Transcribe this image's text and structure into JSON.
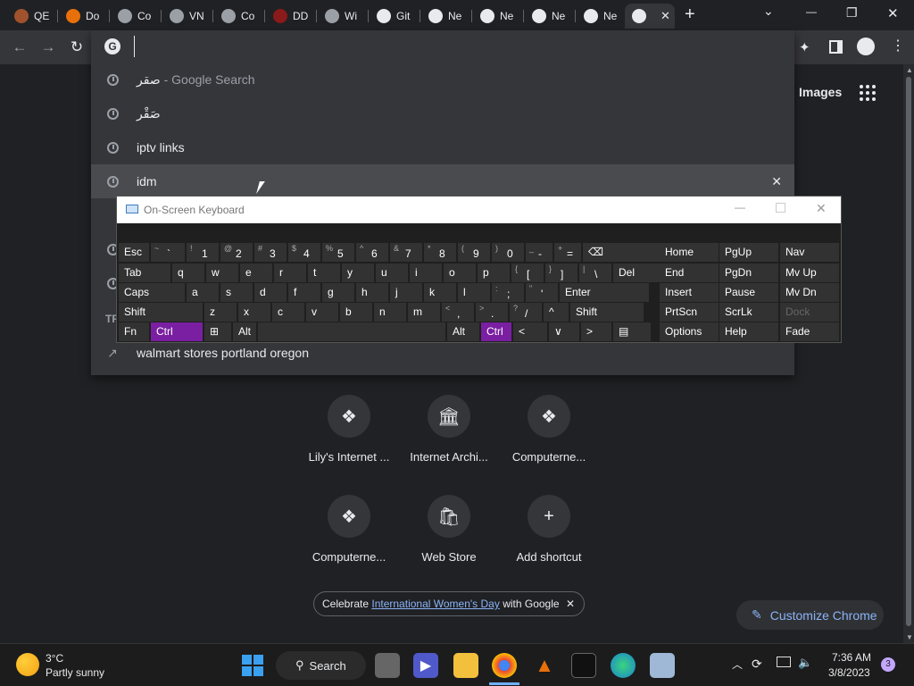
{
  "tabs": [
    {
      "label": "QE",
      "icon": "tab-favicon-qe",
      "color": "#a0522d"
    },
    {
      "label": "Do",
      "icon": "vlc-icon",
      "color": "#e8700a"
    },
    {
      "label": "Co",
      "icon": "computerese-icon",
      "color": "#9aa0a6"
    },
    {
      "label": "VN",
      "icon": "computerese-icon",
      "color": "#9aa0a6"
    },
    {
      "label": "Co",
      "icon": "computerese-icon",
      "color": "#9aa0a6"
    },
    {
      "label": "DD",
      "icon": "ddg-icon",
      "color": "#8b1a1a"
    },
    {
      "label": "Wi",
      "icon": "wiki-icon",
      "color": "#9aa0a6"
    },
    {
      "label": "Git",
      "icon": "github-icon",
      "color": "#e8eaed"
    },
    {
      "label": "Ne",
      "icon": "chrome-icon",
      "color": "#e8eaed"
    },
    {
      "label": "Ne",
      "icon": "chrome-icon",
      "color": "#e8eaed"
    },
    {
      "label": "Ne",
      "icon": "chrome-icon",
      "color": "#e8eaed"
    },
    {
      "label": "Ne",
      "icon": "chrome-icon",
      "color": "#e8eaed"
    }
  ],
  "active_tab": {
    "close": "✕"
  },
  "new_tab": "+",
  "window": {
    "minimize": "—",
    "restore": "❐",
    "close": "✕",
    "tabsearch": "⌄"
  },
  "nav": {
    "back": "←",
    "forward": "→",
    "reload": "↻"
  },
  "omnibox": {
    "value": "",
    "suggestions": [
      {
        "text": "صقر",
        "suffix": " - Google Search",
        "icon": "history"
      },
      {
        "text": "صَقْر",
        "suffix": "",
        "icon": "history"
      },
      {
        "text": "iptv links",
        "suffix": "",
        "icon": "history"
      },
      {
        "text": "idm",
        "suffix": "",
        "icon": "history",
        "remove": "✕"
      }
    ],
    "trending_header": "TR",
    "trending": [
      {
        "text": "walmart stores portland oregon",
        "icon": "trending"
      }
    ]
  },
  "header_right": {
    "images": "Images"
  },
  "osk": {
    "title": "On-Screen Keyboard",
    "rows": [
      [
        {
          "m": "Esc"
        },
        {
          "s": "~",
          "m": "`"
        },
        {
          "s": "!",
          "m": "1"
        },
        {
          "s": "@",
          "m": "2"
        },
        {
          "s": "#",
          "m": "3"
        },
        {
          "s": "$",
          "m": "4"
        },
        {
          "s": "%",
          "m": "5"
        },
        {
          "s": "^",
          "m": "6"
        },
        {
          "s": "&",
          "m": "7"
        },
        {
          "s": "*",
          "m": "8"
        },
        {
          "s": "(",
          "m": "9"
        },
        {
          "s": ")",
          "m": "0"
        },
        {
          "s": "_",
          "m": "-"
        },
        {
          "s": "+",
          "m": "="
        },
        {
          "m": "⌫"
        }
      ],
      [
        {
          "m": "Tab"
        },
        {
          "m": "q"
        },
        {
          "m": "w"
        },
        {
          "m": "e"
        },
        {
          "m": "r"
        },
        {
          "m": "t"
        },
        {
          "m": "y"
        },
        {
          "m": "u"
        },
        {
          "m": "i"
        },
        {
          "m": "o"
        },
        {
          "m": "p"
        },
        {
          "s": "{",
          "m": "["
        },
        {
          "s": "}",
          "m": "]"
        },
        {
          "s": "|",
          "m": "\\"
        },
        {
          "m": "Del"
        }
      ],
      [
        {
          "m": "Caps"
        },
        {
          "m": "a"
        },
        {
          "m": "s"
        },
        {
          "m": "d"
        },
        {
          "m": "f"
        },
        {
          "m": "g"
        },
        {
          "m": "h"
        },
        {
          "m": "j"
        },
        {
          "m": "k"
        },
        {
          "m": "l"
        },
        {
          "s": ":",
          "m": ";"
        },
        {
          "s": "\"",
          "m": "'"
        },
        {
          "m": "Enter"
        }
      ],
      [
        {
          "m": "Shift"
        },
        {
          "m": "z"
        },
        {
          "m": "x"
        },
        {
          "m": "c"
        },
        {
          "m": "v"
        },
        {
          "m": "b"
        },
        {
          "m": "n"
        },
        {
          "m": "m"
        },
        {
          "s": "<",
          "m": ","
        },
        {
          "s": ">",
          "m": "."
        },
        {
          "s": "?",
          "m": "/"
        },
        {
          "m": "^"
        },
        {
          "m": "Shift"
        }
      ],
      [
        {
          "m": "Fn"
        },
        {
          "m": "Ctrl",
          "hi": true
        },
        {
          "m": "⊞"
        },
        {
          "m": "Alt"
        },
        {
          "m": ""
        },
        {
          "m": "Alt"
        },
        {
          "m": "Ctrl",
          "hi": true
        },
        {
          "m": "<"
        },
        {
          "m": "∨"
        },
        {
          "m": ">"
        },
        {
          "m": "▤"
        }
      ]
    ],
    "nav_keys": [
      [
        "Home",
        "PgUp",
        "Nav"
      ],
      [
        "End",
        "PgDn",
        "Mv Up"
      ],
      [
        "Insert",
        "Pause",
        "Mv Dn"
      ],
      [
        "PrtScn",
        "ScrLk",
        "Dock"
      ],
      [
        "Options",
        "Help",
        "Fade"
      ]
    ]
  },
  "shortcuts": [
    {
      "label": "Lily's Internet ...",
      "icon": "computerese-icon",
      "glyph": "❖"
    },
    {
      "label": "Internet Archi...",
      "icon": "archive-icon",
      "glyph": "🏛"
    },
    {
      "label": "Computerne...",
      "icon": "computerese-icon",
      "glyph": "❖"
    },
    {
      "label": "Computerne...",
      "icon": "computerese-icon",
      "glyph": "❖"
    },
    {
      "label": "Web Store",
      "icon": "webstore-icon",
      "glyph": "🛍"
    },
    {
      "label": "Add shortcut",
      "icon": "plus-icon",
      "glyph": "+"
    }
  ],
  "doodle": {
    "prefix": "Celebrate ",
    "link": "International Women's Day",
    "suffix": " with Google",
    "close": "✕"
  },
  "customize": {
    "label": "Customize Chrome"
  },
  "weather": {
    "temp": "3°C",
    "desc": "Partly sunny"
  },
  "taskbar": {
    "search": "Search"
  },
  "clock": {
    "time": "7:36 AM",
    "date": "3/8/2023",
    "badge": "3"
  }
}
